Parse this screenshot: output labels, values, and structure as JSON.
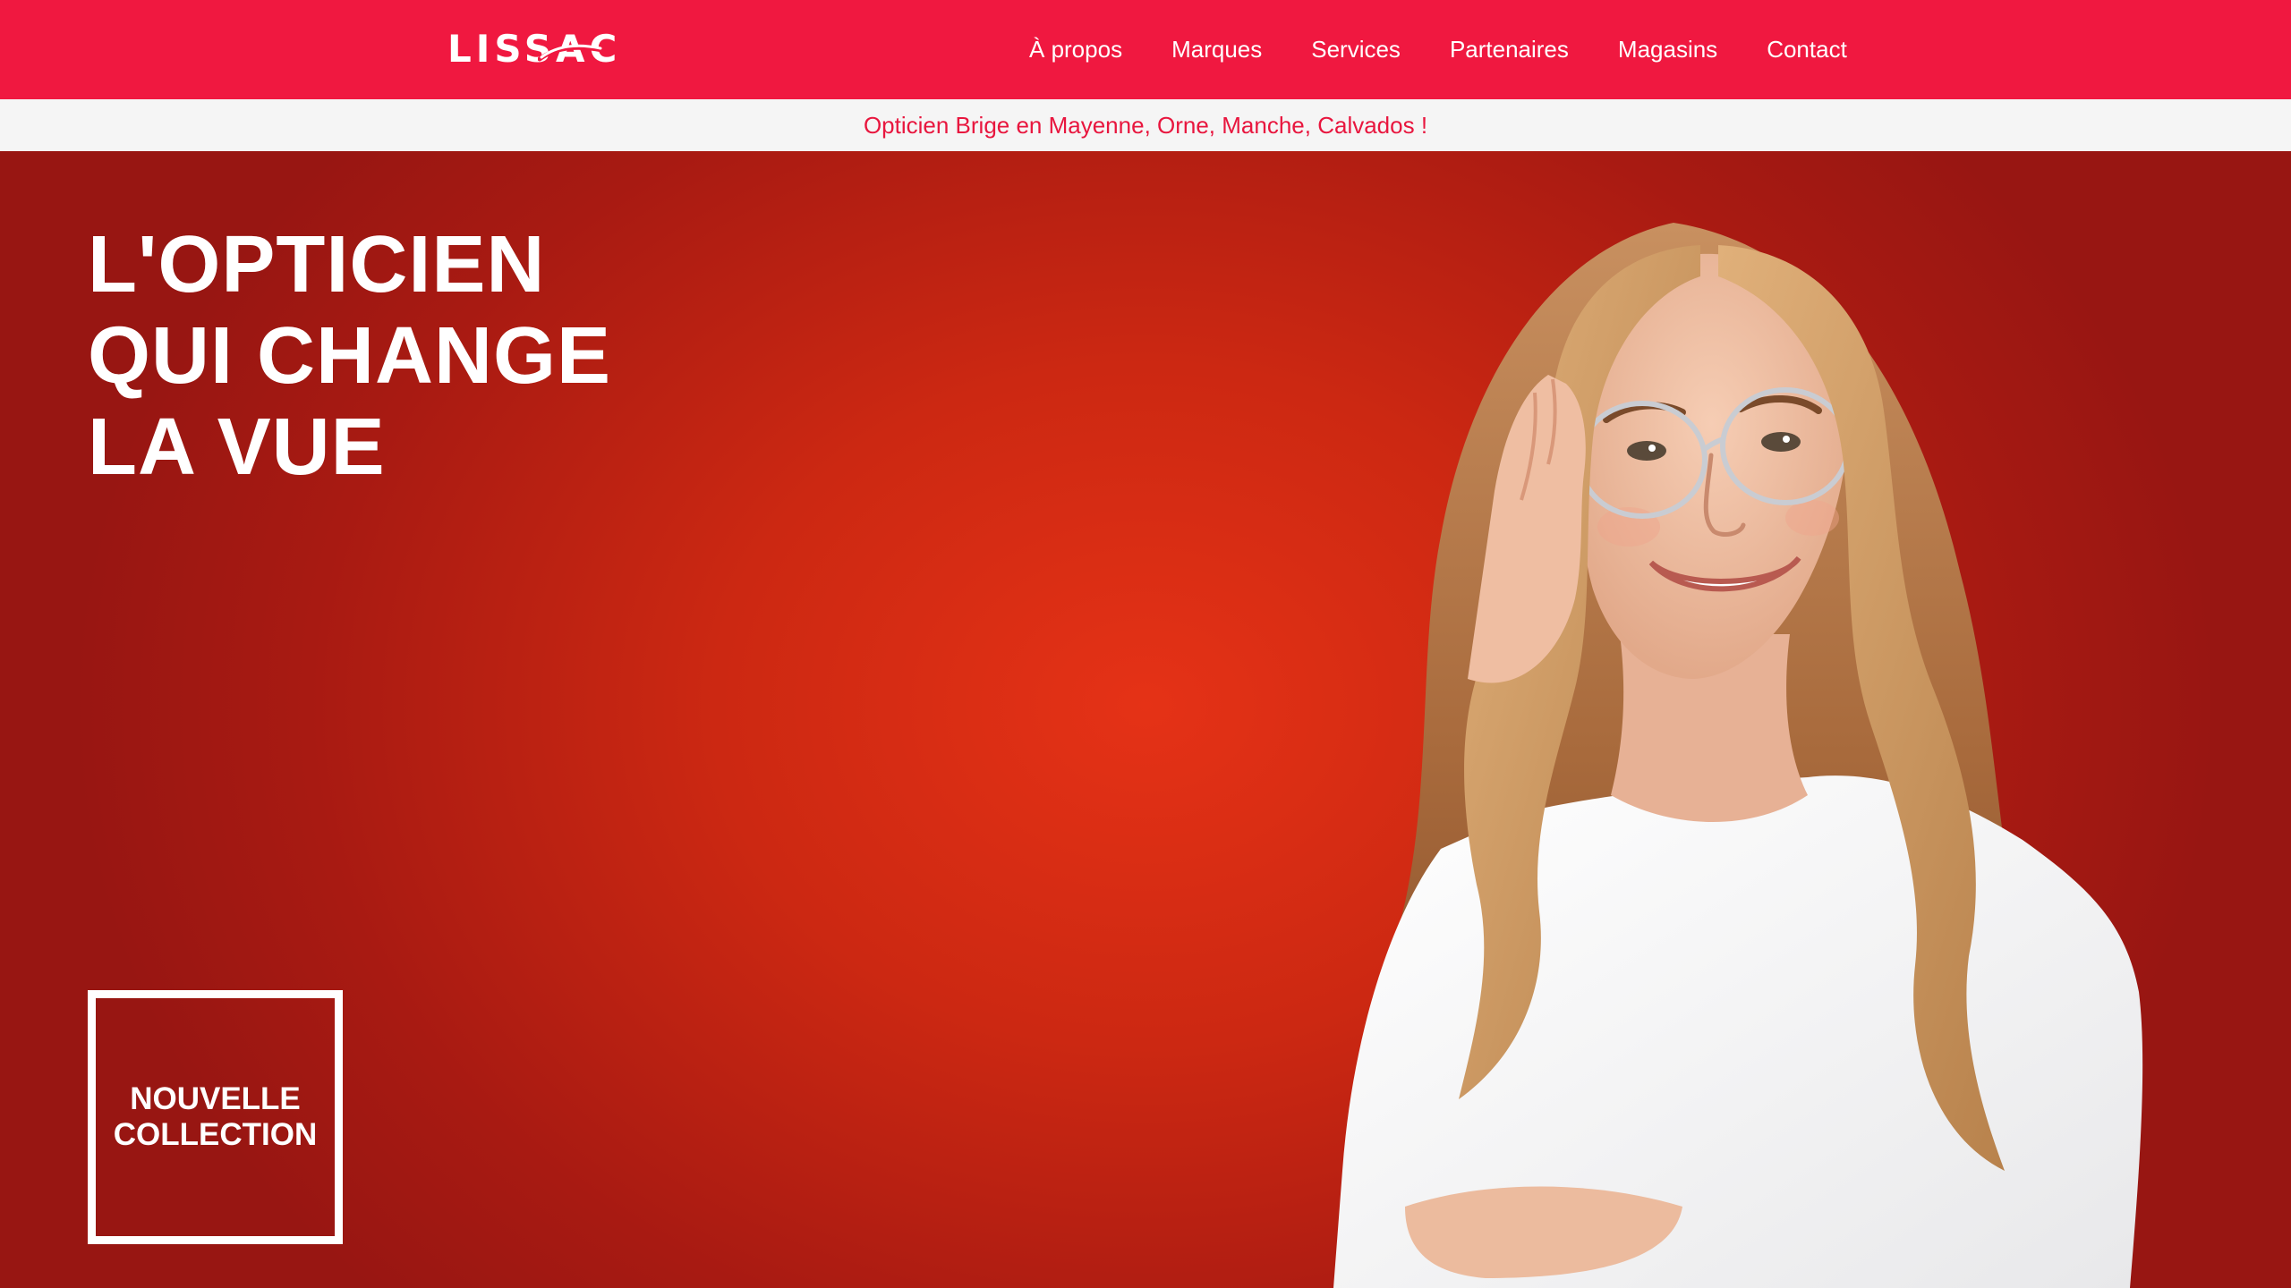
{
  "header": {
    "logo_text_main": "LISS",
    "logo_text_accent": "AC",
    "nav_items": [
      {
        "label": "À propos"
      },
      {
        "label": "Marques"
      },
      {
        "label": "Services"
      },
      {
        "label": "Partenaires"
      },
      {
        "label": "Magasins"
      },
      {
        "label": "Contact"
      }
    ]
  },
  "subbanner": {
    "text": "Opticien Brige en Mayenne, Orne, Manche, Calvados !"
  },
  "hero": {
    "title_lines": [
      "L'OPTICIEN",
      "QUI CHANGE",
      "LA VUE"
    ],
    "collection_lines": [
      "NOUVELLE",
      "COLLECTION"
    ],
    "image_subject": "smiling-woman-with-glasses"
  },
  "colors": {
    "brand_red": "#f01840",
    "hero_red": "#e53216",
    "subbanner_bg": "#f5f5f5",
    "subbanner_text": "#e8163e"
  }
}
